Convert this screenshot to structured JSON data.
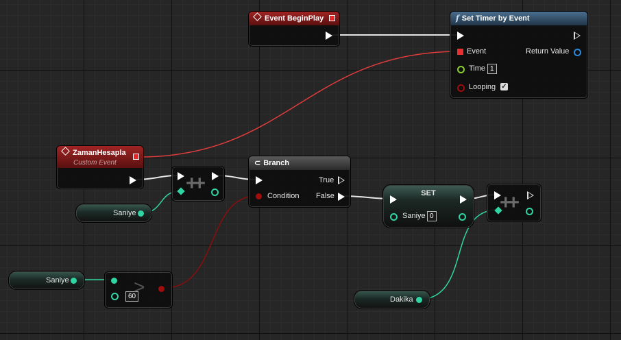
{
  "colors": {
    "exec_wire": "#e6e6e6",
    "event_wire": "#e03c3c",
    "int_wire": "#2fd6a4",
    "bool_wire": "#8b0d0d",
    "int_pin": "#2fd6a4",
    "float_pin": "#8ccf2c",
    "bool_pin": "#a00d0d",
    "object_pin": "#2b8ae0"
  },
  "nodes": {
    "begin_play": {
      "title": "Event BeginPlay"
    },
    "set_timer": {
      "title": "Set Timer by Event",
      "event_label": "Event",
      "time_label": "Time",
      "time_value": "1",
      "looping_label": "Looping",
      "looping_checked": "✓",
      "return_label": "Return Value"
    },
    "custom_event": {
      "title": "ZamanHesapla",
      "subtitle": "Custom Event"
    },
    "increment": {
      "icon": "++"
    },
    "branch": {
      "title": "Branch",
      "condition_label": "Condition",
      "true_label": "True",
      "false_label": "False"
    },
    "set": {
      "title": "SET",
      "var_label": "Saniye",
      "var_value": "0"
    },
    "increment2": {
      "icon": "++"
    },
    "compare": {
      "value": "60",
      "icon": "greater-than-icon"
    },
    "var_saniye_1": {
      "label": "Saniye"
    },
    "var_saniye_2": {
      "label": "Saniye"
    },
    "var_dakika": {
      "label": "Dakika"
    }
  }
}
